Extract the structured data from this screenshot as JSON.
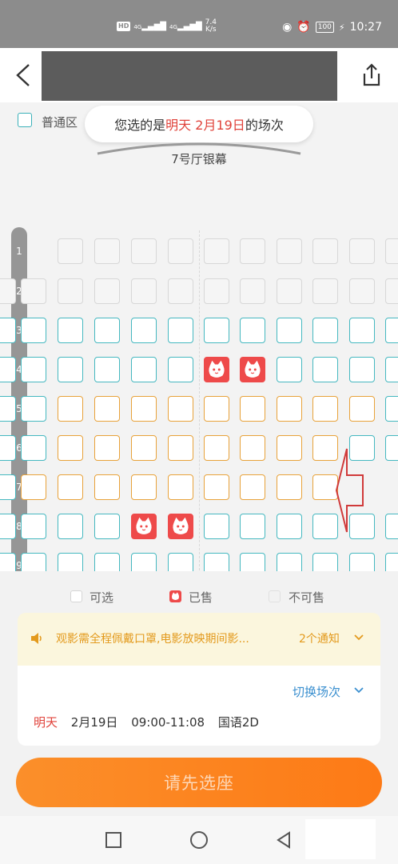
{
  "status_bar": {
    "network_chip": "HD",
    "sim1": "4G",
    "sim2": "4G",
    "speed_value": "7.4",
    "speed_unit": "K/s",
    "battery": "100",
    "time": "10:27"
  },
  "nav": {
    "back_icon": "chevron-left-icon",
    "share_icon": "share-icon"
  },
  "area": {
    "label": "普通区"
  },
  "bubble": {
    "prefix": "您选的是",
    "highlight": "明天 2月19日",
    "suffix": "的场次"
  },
  "screen_name": "7号厅银幕",
  "rows": [
    "1",
    "2",
    "3",
    "4",
    "5",
    "6",
    "7",
    "8",
    "9"
  ],
  "legend": {
    "available": "可选",
    "sold": "已售",
    "unavailable": "不可售"
  },
  "notice": {
    "icon": "speaker-icon",
    "text": "观影需全程佩戴口罩,电影放映期间影...",
    "count": "2个通知"
  },
  "session": {
    "switch_label": "切换场次",
    "day": "明天",
    "date": "2月19日",
    "time": "09:00-11:08",
    "format": "国语2D"
  },
  "cta": "请先选座",
  "colors": {
    "accent_red": "#e0423a",
    "seat_available": "#45b8c0",
    "seat_orange": "#e8a23a",
    "sold": "#ee4a4a",
    "cta": "#fb8f2a"
  }
}
